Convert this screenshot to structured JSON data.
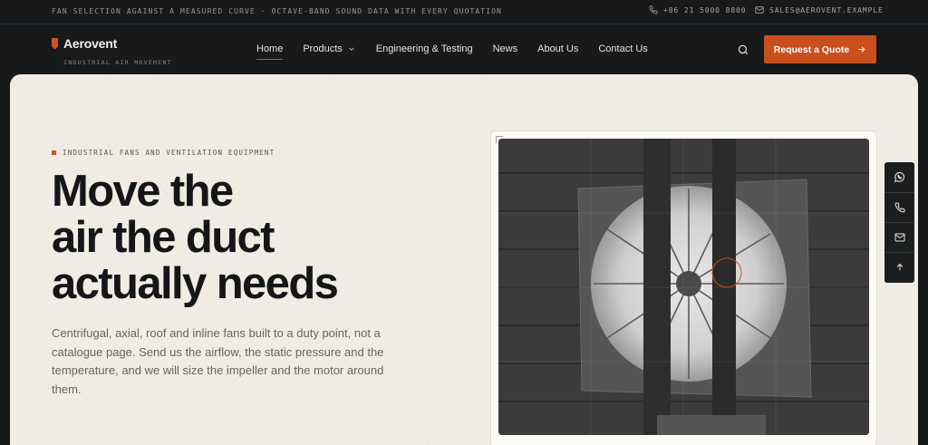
{
  "topbar": {
    "tagline": "FAN SELECTION AGAINST A MEASURED CURVE · OCTAVE-BAND SOUND DATA WITH EVERY QUOTATION",
    "phone": "+86 21 5000 8800",
    "email": "SALES@AEROVENT.EXAMPLE"
  },
  "brand": {
    "name": "Aerovent",
    "subtitle": "INDUSTRIAL AIR MOVEMENT",
    "accent": "#d4551f"
  },
  "nav": {
    "items": [
      {
        "label": "Home",
        "active": true
      },
      {
        "label": "Products",
        "has_dropdown": true
      },
      {
        "label": "Engineering & Testing"
      },
      {
        "label": "News"
      },
      {
        "label": "About Us"
      },
      {
        "label": "Contact Us"
      }
    ],
    "search_icon": "search-icon",
    "cta_label": "Request a Quote"
  },
  "hero": {
    "eyebrow": "INDUSTRIAL FANS AND VENTILATION EQUIPMENT",
    "headline_lines": [
      "Move the",
      "air the duct",
      "actually needs"
    ],
    "lede": "Centrifugal, axial, roof and inline fans built to a duty point, not a catalogue page. Send us the airflow, the static pressure and the temperature, and we will size the impeller and the motor around them."
  },
  "side_actions": [
    "whatsapp-icon",
    "phone-icon",
    "mail-icon",
    "arrow-up-icon"
  ],
  "colors": {
    "page_dark": "#17191b",
    "hero_bg": "#f1ede5",
    "cta": "#c9501e"
  }
}
